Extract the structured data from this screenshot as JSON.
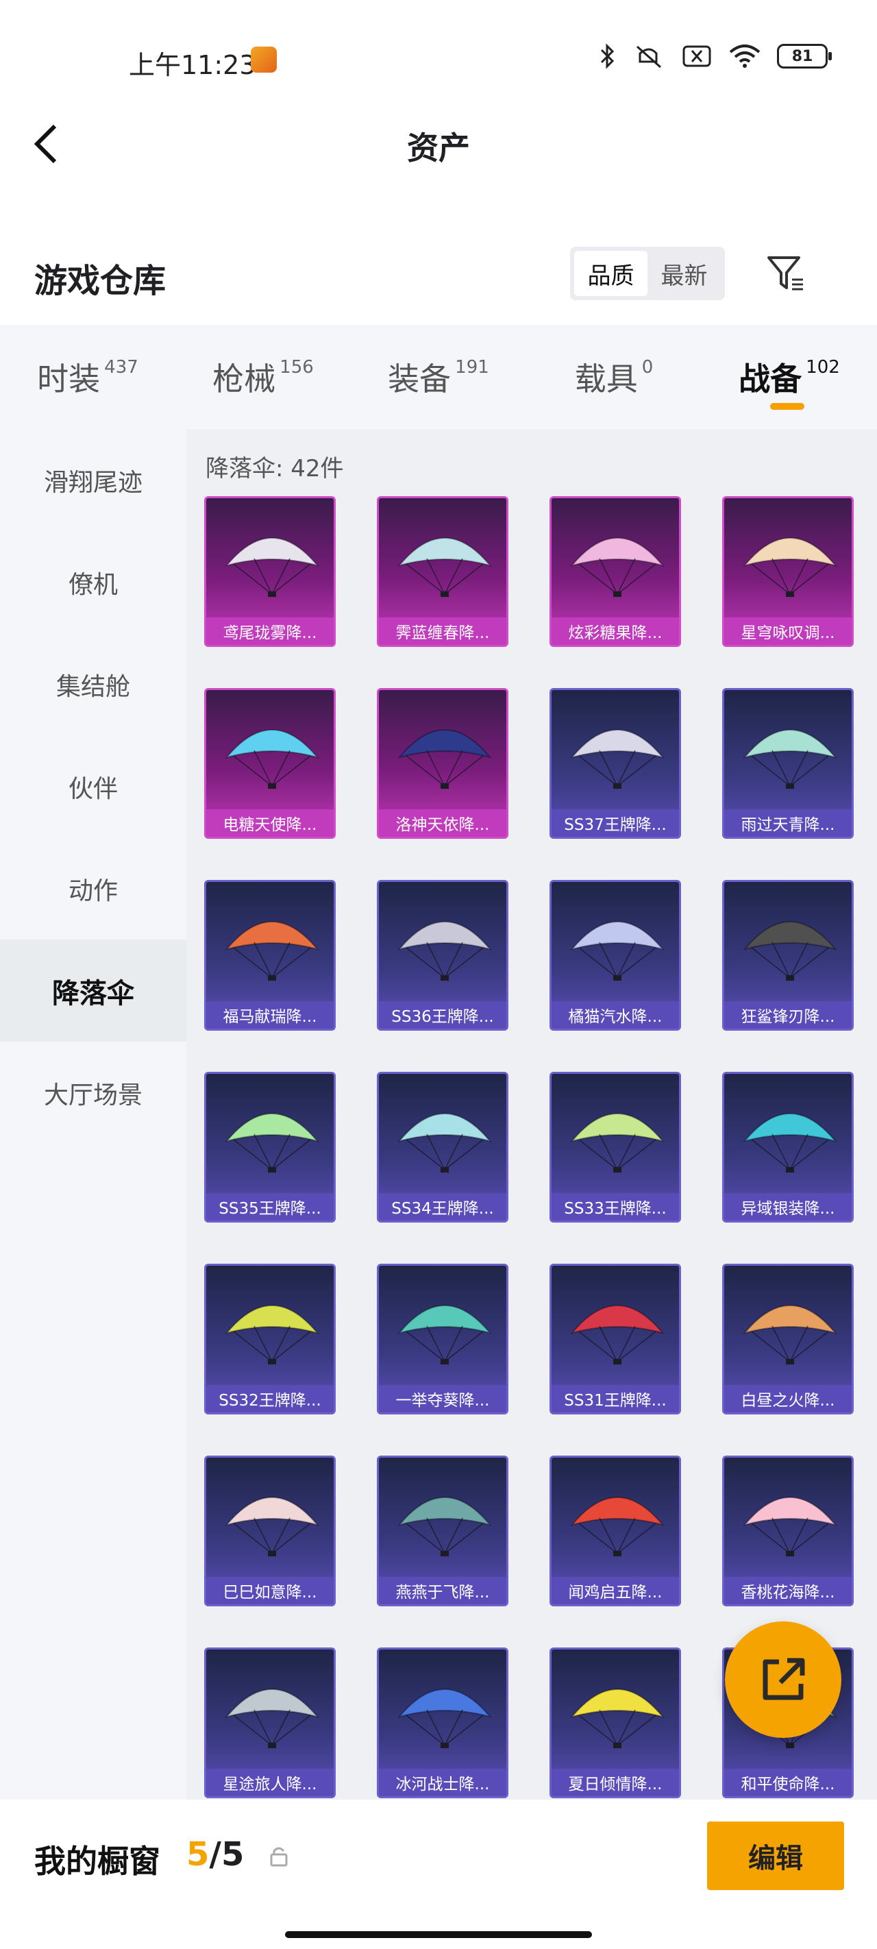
{
  "status": {
    "time": "上午11:23",
    "battery": "81"
  },
  "nav": {
    "title": "资产"
  },
  "warehouse": {
    "title": "游戏仓库",
    "sort_options": [
      "品质",
      "最新"
    ],
    "sort_selected": "品质"
  },
  "categories": [
    {
      "name": "时装",
      "count": "437"
    },
    {
      "name": "枪械",
      "count": "156"
    },
    {
      "name": "装备",
      "count": "191"
    },
    {
      "name": "载具",
      "count": "0"
    },
    {
      "name": "战备",
      "count": "102",
      "active": true
    }
  ],
  "sidebar": [
    {
      "label": "滑翔尾迹"
    },
    {
      "label": "僚机"
    },
    {
      "label": "集结舱"
    },
    {
      "label": "伙伴"
    },
    {
      "label": "动作"
    },
    {
      "label": "降落伞",
      "active": true
    },
    {
      "label": "大厅场景"
    }
  ],
  "main": {
    "count_label": "降落伞: 42件",
    "items": [
      {
        "name": "鸢尾珑雾降...",
        "rarity": "pink",
        "color": "#e8e4ee"
      },
      {
        "name": "霁蓝缠春降...",
        "rarity": "pink",
        "color": "#bfe3e8"
      },
      {
        "name": "炫彩糖果降...",
        "rarity": "pink",
        "color": "#f0b8e0"
      },
      {
        "name": "星穹咏叹调...",
        "rarity": "pink",
        "color": "#f3d9b8"
      },
      {
        "name": "电糖天使降...",
        "rarity": "pink",
        "color": "#5fd0f0"
      },
      {
        "name": "洛神天依降...",
        "rarity": "pink",
        "color": "#2e3a8c"
      },
      {
        "name": "SS37王牌降...",
        "rarity": "purple",
        "color": "#d8d8e8"
      },
      {
        "name": "雨过天青降...",
        "rarity": "purple",
        "color": "#a8e0d4"
      },
      {
        "name": "福马献瑞降...",
        "rarity": "purple",
        "color": "#e87040"
      },
      {
        "name": "SS36王牌降...",
        "rarity": "purple",
        "color": "#c8c8d8"
      },
      {
        "name": "橘猫汽水降...",
        "rarity": "purple",
        "color": "#c0c8f0"
      },
      {
        "name": "狂鲨锋刃降...",
        "rarity": "purple",
        "color": "#505050"
      },
      {
        "name": "SS35王牌降...",
        "rarity": "purple",
        "color": "#a8e8a0"
      },
      {
        "name": "SS34王牌降...",
        "rarity": "purple",
        "color": "#a8e0e8"
      },
      {
        "name": "SS33王牌降...",
        "rarity": "purple",
        "color": "#c8e890"
      },
      {
        "name": "异域银装降...",
        "rarity": "purple",
        "color": "#40c8d8"
      },
      {
        "name": "SS32王牌降...",
        "rarity": "purple",
        "color": "#d8e050"
      },
      {
        "name": "一举夺葵降...",
        "rarity": "purple",
        "color": "#58c8b8"
      },
      {
        "name": "SS31王牌降...",
        "rarity": "purple",
        "color": "#d83848"
      },
      {
        "name": "白昼之火降...",
        "rarity": "purple",
        "color": "#e8a060"
      },
      {
        "name": "巳巳如意降...",
        "rarity": "purple",
        "color": "#f0d8d8"
      },
      {
        "name": "燕燕于飞降...",
        "rarity": "purple",
        "color": "#70a8a8"
      },
      {
        "name": "闻鸡启五降...",
        "rarity": "purple",
        "color": "#e84838"
      },
      {
        "name": "香桃花海降...",
        "rarity": "purple",
        "color": "#f8c0d0"
      },
      {
        "name": "星途旅人降...",
        "rarity": "purple",
        "color": "#c0c8d0"
      },
      {
        "name": "冰河战士降...",
        "rarity": "purple",
        "color": "#4878e0"
      },
      {
        "name": "夏日倾情降...",
        "rarity": "purple",
        "color": "#f0e040"
      },
      {
        "name": "和平使命降...",
        "rarity": "purple",
        "color": "#60a070"
      }
    ]
  },
  "bottom": {
    "showcase_label": "我的橱窗",
    "showcase_current": "5",
    "showcase_total": "/5",
    "edit_label": "编辑"
  },
  "colors": {
    "accent": "#f5a300",
    "pink_card": "#c13cbc",
    "purple_card": "#5a4cb8"
  }
}
